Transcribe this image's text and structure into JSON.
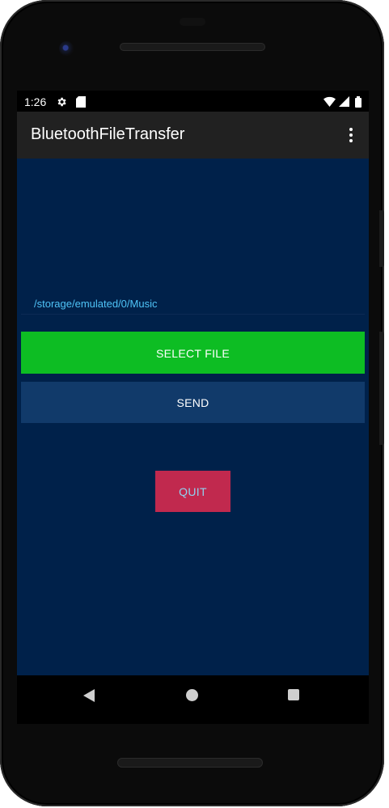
{
  "status_bar": {
    "time": "1:26",
    "left_icons": [
      "gear-icon",
      "sd-card-icon"
    ],
    "right_icons": [
      "wifi-icon",
      "signal-icon",
      "battery-icon"
    ]
  },
  "app_bar": {
    "title": "BluetoothFileTransfer",
    "menu_icon": "overflow-menu-icon"
  },
  "main": {
    "selected_path": "/storage/emulated/0/Music",
    "select_file_label": "SELECT FILE",
    "send_label": "SEND",
    "quit_label": "QUIT"
  },
  "nav_bar": {
    "icons": [
      "back-icon",
      "home-icon",
      "recents-icon"
    ]
  },
  "colors": {
    "background": "#00214a",
    "app_bar": "#212121",
    "select_button": "#0dbd23",
    "send_button": "#113a6a",
    "quit_button": "#c1294e",
    "path_text": "#4fc3f7"
  }
}
